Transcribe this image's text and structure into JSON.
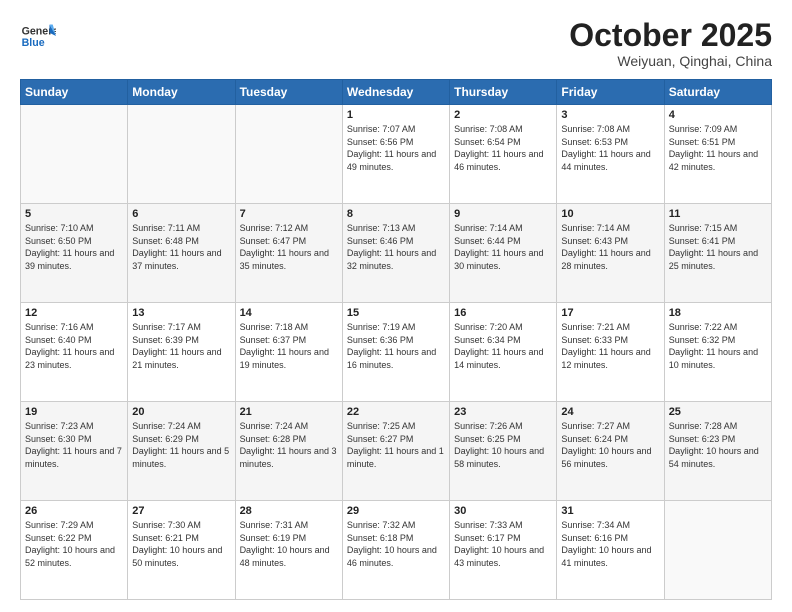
{
  "header": {
    "logo_general": "General",
    "logo_blue": "Blue",
    "month_title": "October 2025",
    "location": "Weiyuan, Qinghai, China"
  },
  "weekdays": [
    "Sunday",
    "Monday",
    "Tuesday",
    "Wednesday",
    "Thursday",
    "Friday",
    "Saturday"
  ],
  "weeks": [
    [
      {
        "day": "",
        "info": ""
      },
      {
        "day": "",
        "info": ""
      },
      {
        "day": "",
        "info": ""
      },
      {
        "day": "1",
        "info": "Sunrise: 7:07 AM\nSunset: 6:56 PM\nDaylight: 11 hours and 49 minutes."
      },
      {
        "day": "2",
        "info": "Sunrise: 7:08 AM\nSunset: 6:54 PM\nDaylight: 11 hours and 46 minutes."
      },
      {
        "day": "3",
        "info": "Sunrise: 7:08 AM\nSunset: 6:53 PM\nDaylight: 11 hours and 44 minutes."
      },
      {
        "day": "4",
        "info": "Sunrise: 7:09 AM\nSunset: 6:51 PM\nDaylight: 11 hours and 42 minutes."
      }
    ],
    [
      {
        "day": "5",
        "info": "Sunrise: 7:10 AM\nSunset: 6:50 PM\nDaylight: 11 hours and 39 minutes."
      },
      {
        "day": "6",
        "info": "Sunrise: 7:11 AM\nSunset: 6:48 PM\nDaylight: 11 hours and 37 minutes."
      },
      {
        "day": "7",
        "info": "Sunrise: 7:12 AM\nSunset: 6:47 PM\nDaylight: 11 hours and 35 minutes."
      },
      {
        "day": "8",
        "info": "Sunrise: 7:13 AM\nSunset: 6:46 PM\nDaylight: 11 hours and 32 minutes."
      },
      {
        "day": "9",
        "info": "Sunrise: 7:14 AM\nSunset: 6:44 PM\nDaylight: 11 hours and 30 minutes."
      },
      {
        "day": "10",
        "info": "Sunrise: 7:14 AM\nSunset: 6:43 PM\nDaylight: 11 hours and 28 minutes."
      },
      {
        "day": "11",
        "info": "Sunrise: 7:15 AM\nSunset: 6:41 PM\nDaylight: 11 hours and 25 minutes."
      }
    ],
    [
      {
        "day": "12",
        "info": "Sunrise: 7:16 AM\nSunset: 6:40 PM\nDaylight: 11 hours and 23 minutes."
      },
      {
        "day": "13",
        "info": "Sunrise: 7:17 AM\nSunset: 6:39 PM\nDaylight: 11 hours and 21 minutes."
      },
      {
        "day": "14",
        "info": "Sunrise: 7:18 AM\nSunset: 6:37 PM\nDaylight: 11 hours and 19 minutes."
      },
      {
        "day": "15",
        "info": "Sunrise: 7:19 AM\nSunset: 6:36 PM\nDaylight: 11 hours and 16 minutes."
      },
      {
        "day": "16",
        "info": "Sunrise: 7:20 AM\nSunset: 6:34 PM\nDaylight: 11 hours and 14 minutes."
      },
      {
        "day": "17",
        "info": "Sunrise: 7:21 AM\nSunset: 6:33 PM\nDaylight: 11 hours and 12 minutes."
      },
      {
        "day": "18",
        "info": "Sunrise: 7:22 AM\nSunset: 6:32 PM\nDaylight: 11 hours and 10 minutes."
      }
    ],
    [
      {
        "day": "19",
        "info": "Sunrise: 7:23 AM\nSunset: 6:30 PM\nDaylight: 11 hours and 7 minutes."
      },
      {
        "day": "20",
        "info": "Sunrise: 7:24 AM\nSunset: 6:29 PM\nDaylight: 11 hours and 5 minutes."
      },
      {
        "day": "21",
        "info": "Sunrise: 7:24 AM\nSunset: 6:28 PM\nDaylight: 11 hours and 3 minutes."
      },
      {
        "day": "22",
        "info": "Sunrise: 7:25 AM\nSunset: 6:27 PM\nDaylight: 11 hours and 1 minute."
      },
      {
        "day": "23",
        "info": "Sunrise: 7:26 AM\nSunset: 6:25 PM\nDaylight: 10 hours and 58 minutes."
      },
      {
        "day": "24",
        "info": "Sunrise: 7:27 AM\nSunset: 6:24 PM\nDaylight: 10 hours and 56 minutes."
      },
      {
        "day": "25",
        "info": "Sunrise: 7:28 AM\nSunset: 6:23 PM\nDaylight: 10 hours and 54 minutes."
      }
    ],
    [
      {
        "day": "26",
        "info": "Sunrise: 7:29 AM\nSunset: 6:22 PM\nDaylight: 10 hours and 52 minutes."
      },
      {
        "day": "27",
        "info": "Sunrise: 7:30 AM\nSunset: 6:21 PM\nDaylight: 10 hours and 50 minutes."
      },
      {
        "day": "28",
        "info": "Sunrise: 7:31 AM\nSunset: 6:19 PM\nDaylight: 10 hours and 48 minutes."
      },
      {
        "day": "29",
        "info": "Sunrise: 7:32 AM\nSunset: 6:18 PM\nDaylight: 10 hours and 46 minutes."
      },
      {
        "day": "30",
        "info": "Sunrise: 7:33 AM\nSunset: 6:17 PM\nDaylight: 10 hours and 43 minutes."
      },
      {
        "day": "31",
        "info": "Sunrise: 7:34 AM\nSunset: 6:16 PM\nDaylight: 10 hours and 41 minutes."
      },
      {
        "day": "",
        "info": ""
      }
    ]
  ]
}
